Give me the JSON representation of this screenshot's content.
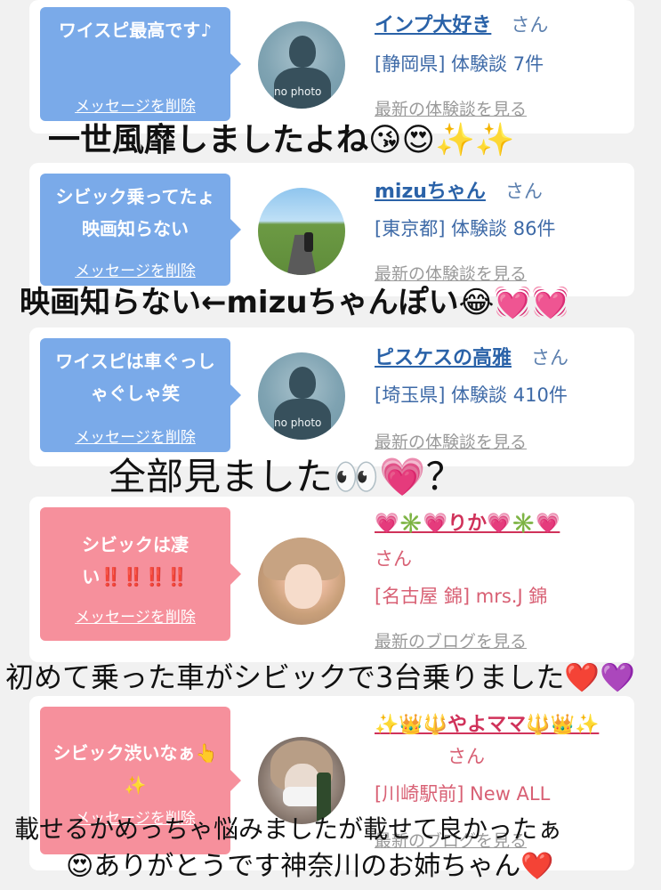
{
  "cards": [
    {
      "message": "ワイスピ最高です♪",
      "delete_label": "メッセージを削除",
      "avatar_label": "no photo",
      "name": "インプ大好き",
      "suffix": "さん",
      "info": "[静岡県] 体験談 7件",
      "latest": "最新の体験談を見る"
    },
    {
      "message": "シビック乗ってたょ映画知らない",
      "delete_label": "メッセージを削除",
      "name": "mizuちゃん",
      "suffix": "さん",
      "info": "[東京都] 体験談 86件",
      "latest": "最新の体験談を見る"
    },
    {
      "message": "ワイスピは車ぐっしゃぐしゃ笑",
      "delete_label": "メッセージを削除",
      "avatar_label": "no photo",
      "name": "ピスケスの高雅",
      "suffix": "さん",
      "info": "[埼玉県] 体験談 410件",
      "latest": "最新の体験談を見る"
    },
    {
      "message": "シビックは凄い‼️‼️‼️‼️",
      "delete_label": "メッセージを削除",
      "name": "💗✳️💗りか💗✳️💗",
      "suffix": "さん",
      "info": "[名古屋 錦] mrs.J 錦",
      "latest": "最新のブログを見る"
    },
    {
      "message": "シビック渋いなぁ👆✨",
      "delete_label": "メッセージを削除",
      "name": "✨👑🔱やよママ🔱👑✨",
      "suffix": "さん",
      "info": "[川崎駅前] New ALL",
      "latest": "最新のブログを見る"
    }
  ],
  "captions": [
    "一世風靡しましたよね😘😍✨✨",
    "映画知らない←mizuちゃんぽい😂💓💓",
    "全部見ました👀💗？",
    "初めて乗った車がシビックで3台乗りました❤️💜",
    "載せるかめっちゃ悩みましたが載せて良かったぁ",
    "😍ありがとうです神奈川のお姉ちゃん❤️"
  ],
  "colors": {
    "background": "#f1f1f1",
    "bubble_blue": "#7aaae9",
    "bubble_pink": "#f6909c",
    "name_blue": "#2a62a8",
    "name_pink": "#d0325a"
  }
}
